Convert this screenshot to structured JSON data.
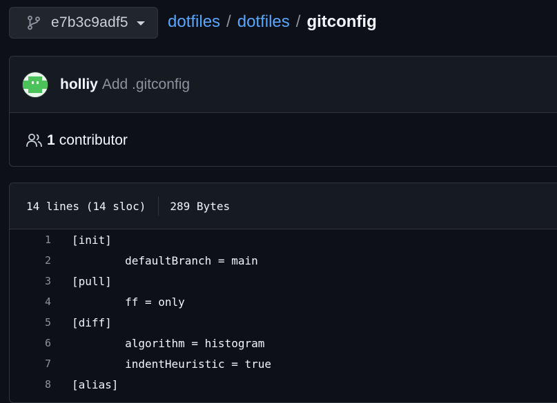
{
  "branch": {
    "label": "e7b3c9adf5"
  },
  "breadcrumb": {
    "owner": "dotfiles",
    "repo": "dotfiles",
    "file": "gitconfig",
    "sep": "/"
  },
  "commit": {
    "author": "holliy",
    "message": "Add .gitconfig",
    "contributors_count": "1",
    "contributors_label": "contributor"
  },
  "file": {
    "lines_info": "14 lines (14 sloc)",
    "size": "289 Bytes",
    "lines": [
      {
        "num": "1",
        "text": "[init]"
      },
      {
        "num": "2",
        "text": "        defaultBranch = main"
      },
      {
        "num": "3",
        "text": "[pull]"
      },
      {
        "num": "4",
        "text": "        ff = only"
      },
      {
        "num": "5",
        "text": "[diff]"
      },
      {
        "num": "6",
        "text": "        algorithm = histogram"
      },
      {
        "num": "7",
        "text": "        indentHeuristic = true"
      },
      {
        "num": "8",
        "text": "[alias]"
      }
    ]
  },
  "icons": {
    "branch": "git-branch-icon",
    "caret": "chevron-down-icon",
    "people": "people-icon"
  },
  "colors": {
    "background": "#0d1117",
    "panel": "#161b22",
    "border": "#30363d",
    "link": "#58a6ff",
    "muted": "#8b949e",
    "avatar": "#4cc35a"
  }
}
